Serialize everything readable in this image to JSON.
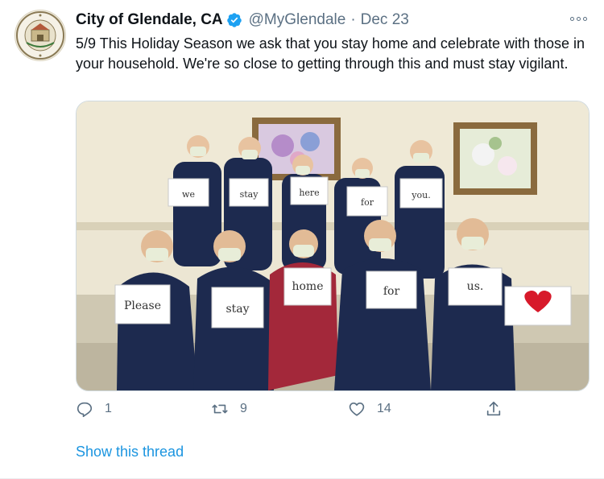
{
  "author": {
    "name": "City of Glendale, CA",
    "handle": "@MyGlendale",
    "separator": "·",
    "date": "Dec 23",
    "verified": true,
    "seal_text": "CITY OF GLENDALE CALIFORNIA"
  },
  "tweet": {
    "text": "5/9 This Holiday Season we ask that you stay home and celebrate with those in your household. We're so close to getting through this and must stay vigilant."
  },
  "media": {
    "signs_back_row": [
      "we",
      "stay",
      "here",
      "for",
      "you."
    ],
    "signs_front_row": [
      "Please",
      "stay",
      "home",
      "for",
      "us."
    ]
  },
  "actions": {
    "reply_count": "1",
    "retweet_count": "9",
    "like_count": "14"
  },
  "show_thread_label": "Show this thread",
  "colors": {
    "link": "#1b95e0",
    "verified": "#1da1f2",
    "secondary_text": "#5b7083",
    "scrubs_navy": "#1d2a4f",
    "scrubs_red": "#a3283a",
    "heart": "#d7192a"
  },
  "icons": [
    "verified-badge-icon",
    "more-icon",
    "reply-icon",
    "retweet-icon",
    "like-icon",
    "share-icon"
  ]
}
